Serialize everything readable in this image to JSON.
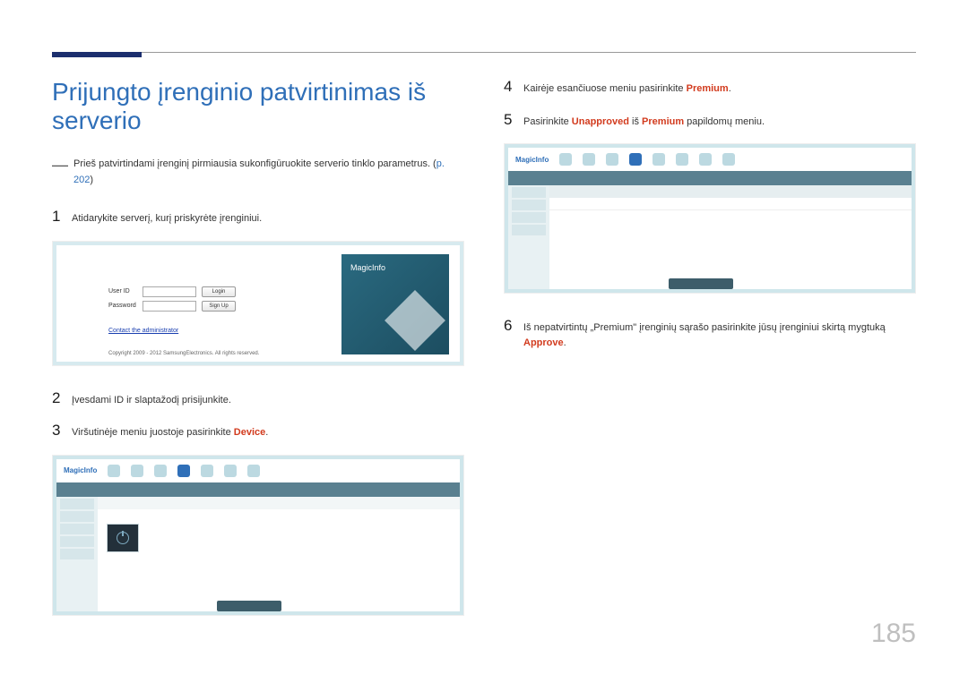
{
  "title": "Prijungto įrenginio patvirtinimas iš serverio",
  "note_dash": "―",
  "note_text_a": "Prieš patvirtindami įrenginį pirmiausia sukonfigūruokite serverio tinklo parametrus. (",
  "note_link": "p. 202",
  "note_text_b": ")",
  "step1_num": "1",
  "step1_text": "Atidarykite serverį, kurį priskyrėte įrenginiui.",
  "step2_num": "2",
  "step2_text": "Įvesdami ID ir slaptažodį prisijunkite.",
  "step3_num": "3",
  "step3_text_a": "Viršutinėje meniu juostoje pasirinkite ",
  "step3_hl": "Device",
  "step3_text_b": ".",
  "step4_num": "4",
  "step4_text_a": "Kairėje esančiuose meniu pasirinkite ",
  "step4_hl": "Premium",
  "step4_text_b": ".",
  "step5_num": "5",
  "step5_text_a": "Pasirinkite ",
  "step5_hl1": "Unapproved",
  "step5_text_b": " iš ",
  "step5_hl2": "Premium",
  "step5_text_c": " papildomų meniu.",
  "step6_num": "6",
  "step6_text_a": "Iš nepatvirtintų „Premium\" įrenginių sąrašo pasirinkite jūsų įrenginiui skirtą mygtuką ",
  "step6_hl": "Approve",
  "step6_text_b": ".",
  "login": {
    "user_label": "User ID",
    "pass_label": "Password",
    "login_btn": "Login",
    "signup_btn": "Sign Up",
    "contact": "Contact the administrator",
    "copyright": "Copyright 2009 - 2012 SamsungElectronics. All rights reserved.",
    "logo": "MagicInfo"
  },
  "app_logo": "MagicInfo",
  "page_number": "185"
}
